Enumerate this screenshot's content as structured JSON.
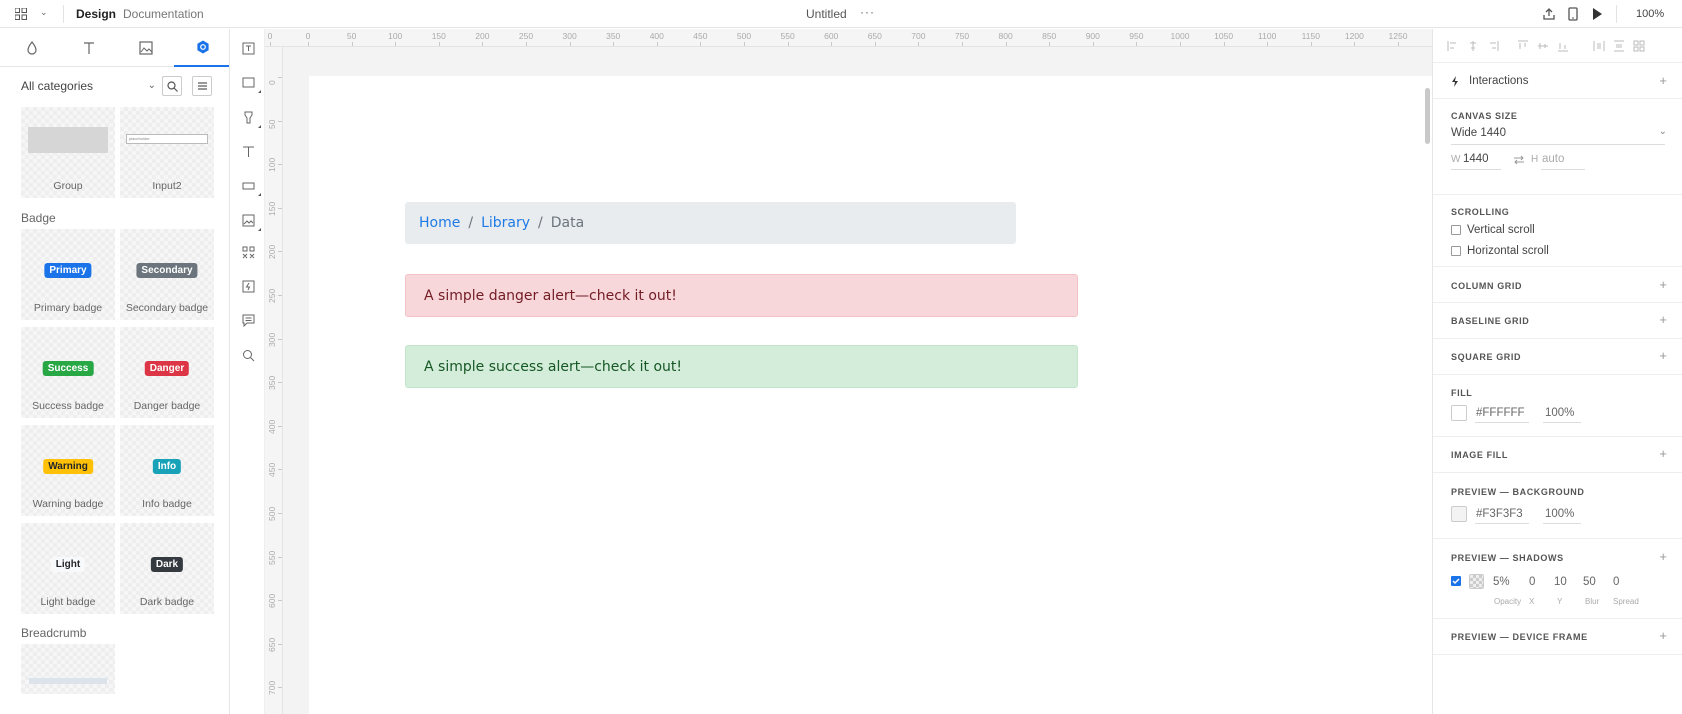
{
  "topbar": {
    "mode_design": "Design",
    "mode_docs": "Documentation",
    "doc_title": "Untitled",
    "more": "···",
    "zoom": "100%"
  },
  "left": {
    "category_filter": "All categories",
    "top_tiles": [
      {
        "label": "Group"
      },
      {
        "label": "Input2",
        "preview_text": "placeholder"
      }
    ],
    "badge_section": "Badge",
    "badges": [
      {
        "badge_text": "Primary",
        "label": "Primary badge",
        "color": "#1a73e8"
      },
      {
        "badge_text": "Secondary",
        "label": "Secondary badge",
        "color": "#6c757d"
      },
      {
        "badge_text": "Success",
        "label": "Success badge",
        "color": "#28a745"
      },
      {
        "badge_text": "Danger",
        "label": "Danger badge",
        "color": "#dc3545"
      },
      {
        "badge_text": "Warning",
        "label": "Warning badge",
        "color": "#ffc107"
      },
      {
        "badge_text": "Info",
        "label": "Info badge",
        "color": "#17a2b8"
      },
      {
        "badge_text": "Light",
        "label": "Light badge",
        "color": "#f8f9fa"
      },
      {
        "badge_text": "Dark",
        "label": "Dark badge",
        "color": "#343a40"
      }
    ],
    "breadcrumb_section": "Breadcrumb"
  },
  "rulers": {
    "top": [
      "0",
      "0",
      "50",
      "100",
      "150",
      "200",
      "250",
      "300",
      "350",
      "400",
      "450",
      "500",
      "550",
      "600",
      "650",
      "700",
      "750",
      "800",
      "850",
      "900",
      "950",
      "1000",
      "1050",
      "1100",
      "1150",
      "1200",
      "1250"
    ],
    "left": [
      "0",
      "50",
      "100",
      "150",
      "200",
      "250",
      "300",
      "350",
      "400",
      "450",
      "500",
      "550",
      "600",
      "650",
      "700"
    ]
  },
  "canvas": {
    "breadcrumb": {
      "home": "Home",
      "library": "Library",
      "current": "Data",
      "separator": "/"
    },
    "alert_danger": "A simple danger alert—check it out!",
    "alert_success": "A simple success alert—check it out!"
  },
  "right": {
    "interactions": "Interactions",
    "canvas_size_head": "CANVAS SIZE",
    "canvas_size_value": "Wide 1440",
    "w_label": "W",
    "w_value": "1440",
    "h_label": "H",
    "h_value": "auto",
    "scrolling_head": "SCROLLING",
    "vertical_scroll": "Vertical scroll",
    "horizontal_scroll": "Horizontal scroll",
    "column_grid": "COLUMN GRID",
    "baseline_grid": "BASELINE GRID",
    "square_grid": "SQUARE GRID",
    "fill_head": "FILL",
    "fill_hex": "#FFFFFF",
    "fill_opacity": "100%",
    "image_fill": "IMAGE FILL",
    "preview_bg_head": "PREVIEW — BACKGROUND",
    "preview_bg_hex": "#F3F3F3",
    "preview_bg_opacity": "100%",
    "preview_shadows_head": "PREVIEW — SHADOWS",
    "shadow_opacity": "5%",
    "shadow_x": "0",
    "shadow_y": "10",
    "shadow_blur": "50",
    "shadow_spread": "0",
    "shadow_labels": {
      "opacity": "Opacity",
      "x": "X",
      "y": "Y",
      "blur": "Blur",
      "spread": "Spread"
    },
    "preview_device_frame": "PREVIEW — DEVICE FRAME"
  }
}
